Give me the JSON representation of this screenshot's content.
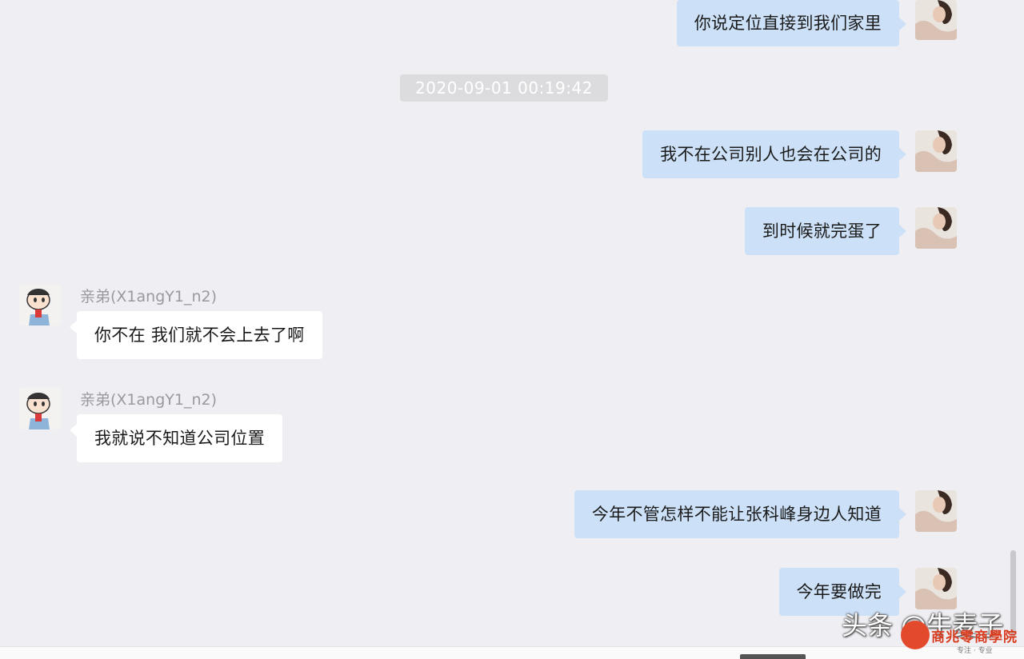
{
  "timestamp": "2020-09-01 00:19:42",
  "messages": [
    {
      "from": "me",
      "text": "你说定位直接到我们家里"
    },
    {
      "from": "me",
      "text": "我不在公司别人也会在公司的"
    },
    {
      "from": "me",
      "text": "到时候就完蛋了"
    },
    {
      "from": "other",
      "sender": "亲弟(X1angY1_n2)",
      "text": "你不在 我们就不会上去了啊"
    },
    {
      "from": "other",
      "sender": "亲弟(X1angY1_n2)",
      "text": "我就说不知道公司位置"
    },
    {
      "from": "me",
      "text": "今年不管怎样不能让张科峰身边人知道"
    },
    {
      "from": "me",
      "text": "今年要做完"
    }
  ],
  "watermark": {
    "text": "头条 @牛麦子",
    "brand": "商兆零商學院",
    "tagline": "专注 · 专业"
  },
  "colors": {
    "background": "#efeff3",
    "outgoing_bubble": "#cce0f7",
    "incoming_bubble": "#ffffff"
  }
}
